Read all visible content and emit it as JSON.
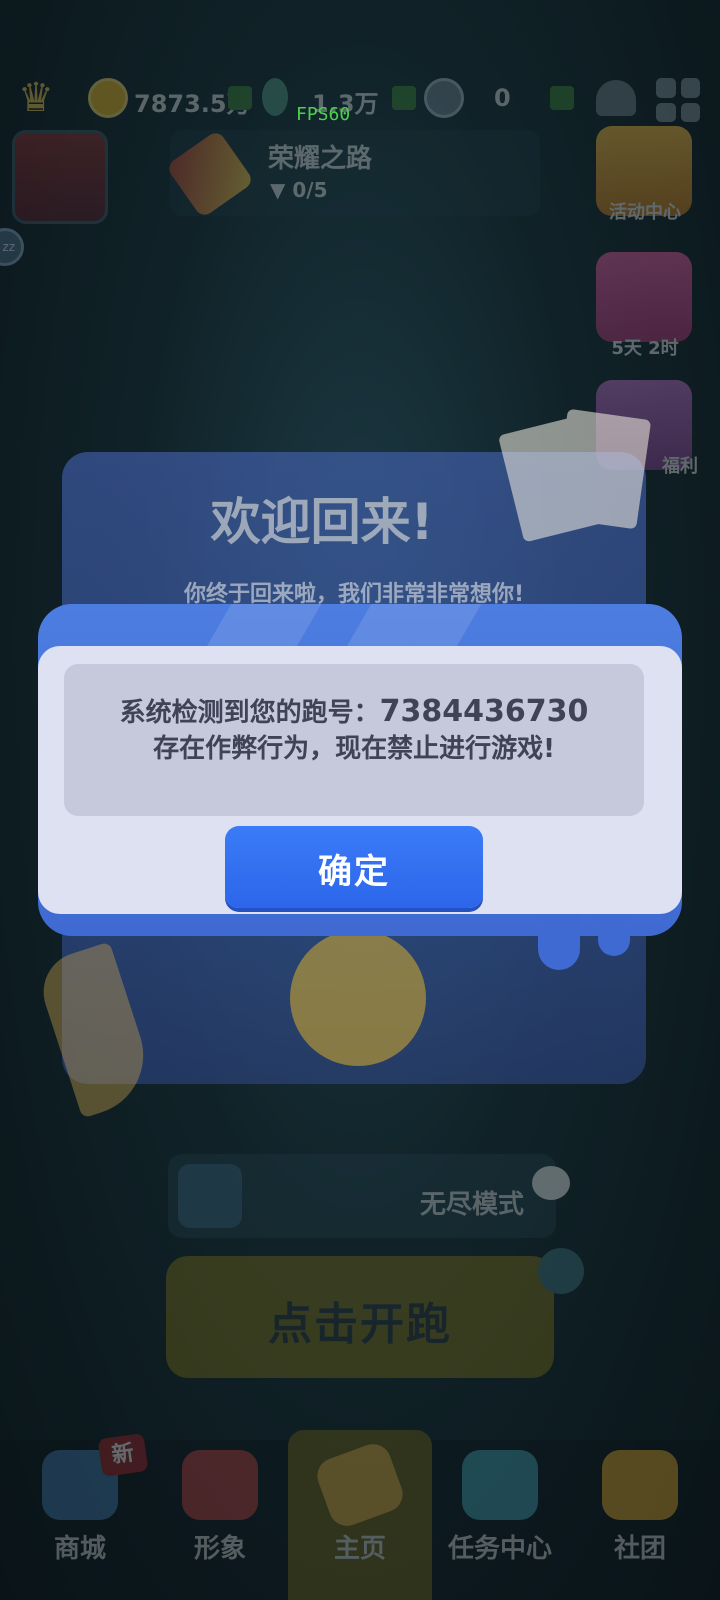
{
  "hud": {
    "coins": "7873.5万",
    "keys": "1.3万",
    "gems": "0",
    "fps": "FPS60"
  },
  "glory_road": {
    "title": "荣耀之路",
    "progress": "0/5"
  },
  "side_buttons": {
    "activity_center": "活动中心",
    "timer": "5天 2时",
    "welfare": "福利"
  },
  "sleep_badge": "zz",
  "welcome_card": {
    "title": "欢迎回来!",
    "subtitle": "你终于回来啦，我们非常非常想你!"
  },
  "modal": {
    "message_line1_prefix": "系统检测到您的跑号：",
    "account_id": "7384436730",
    "message_line2": "存在作弊行为，现在禁止进行游戏!",
    "confirm_label": "确定"
  },
  "mode_panel": {
    "mode_label": "无尽模式"
  },
  "run_button": {
    "label": "点击开跑"
  },
  "bottom_nav": {
    "new_badge": "新",
    "items": [
      {
        "label": "商城"
      },
      {
        "label": "形象"
      },
      {
        "label": "主页"
      },
      {
        "label": "任务中心"
      },
      {
        "label": "社团"
      }
    ]
  },
  "colors": {
    "modal_frame": "#4d7de0",
    "modal_body": "#dde1f2",
    "confirm_button": "#3a7bf7",
    "fps_text": "#4cd14c"
  }
}
